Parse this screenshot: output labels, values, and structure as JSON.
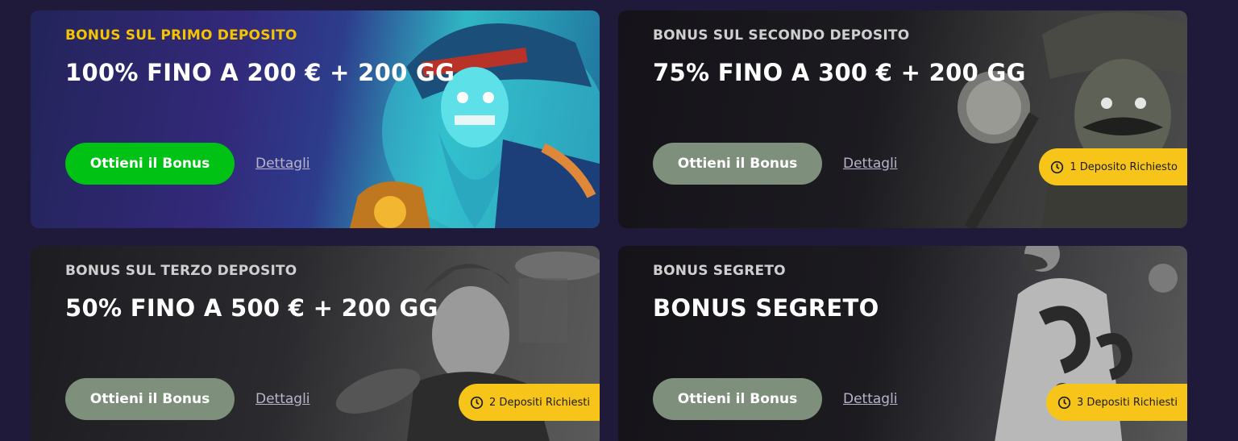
{
  "cards": [
    {
      "eyebrow": "BONUS SUL PRIMO DEPOSITO",
      "headline": "100% FINO A 200 € + 200 GG",
      "cta_label": "Ottieni il Bonus",
      "details_label": "Dettagli",
      "badge": ""
    },
    {
      "eyebrow": "BONUS SUL SECONDO DEPOSITO",
      "headline": "75% FINO A 300 € + 200 GG",
      "cta_label": "Ottieni il Bonus",
      "details_label": "Dettagli",
      "badge": "1 Deposito Richiesto"
    },
    {
      "eyebrow": "BONUS SUL TERZO DEPOSITO",
      "headline": "50% FINO A 500 € + 200 GG",
      "cta_label": "Ottieni il Bonus",
      "details_label": "Dettagli",
      "badge": "2 Depositi Richiesti"
    },
    {
      "eyebrow": "BONUS SEGRETO",
      "headline": "BONUS SEGRETO",
      "cta_label": "Ottieni il Bonus",
      "details_label": "Dettagli",
      "badge": "3 Depositi Richiesti"
    }
  ],
  "colors": {
    "page_bg": "#1f1a3a",
    "active_cta": "#00c214",
    "locked_cta": "#7e907b",
    "eyebrow_active": "#f5c400",
    "badge_bg": "#f7c51a"
  },
  "icons": {
    "badge": "clock-icon",
    "art": [
      "pirate-illustration",
      "cowboy-illustration",
      "aviator-woman-illustration",
      "mystery-gift-illustration"
    ]
  }
}
